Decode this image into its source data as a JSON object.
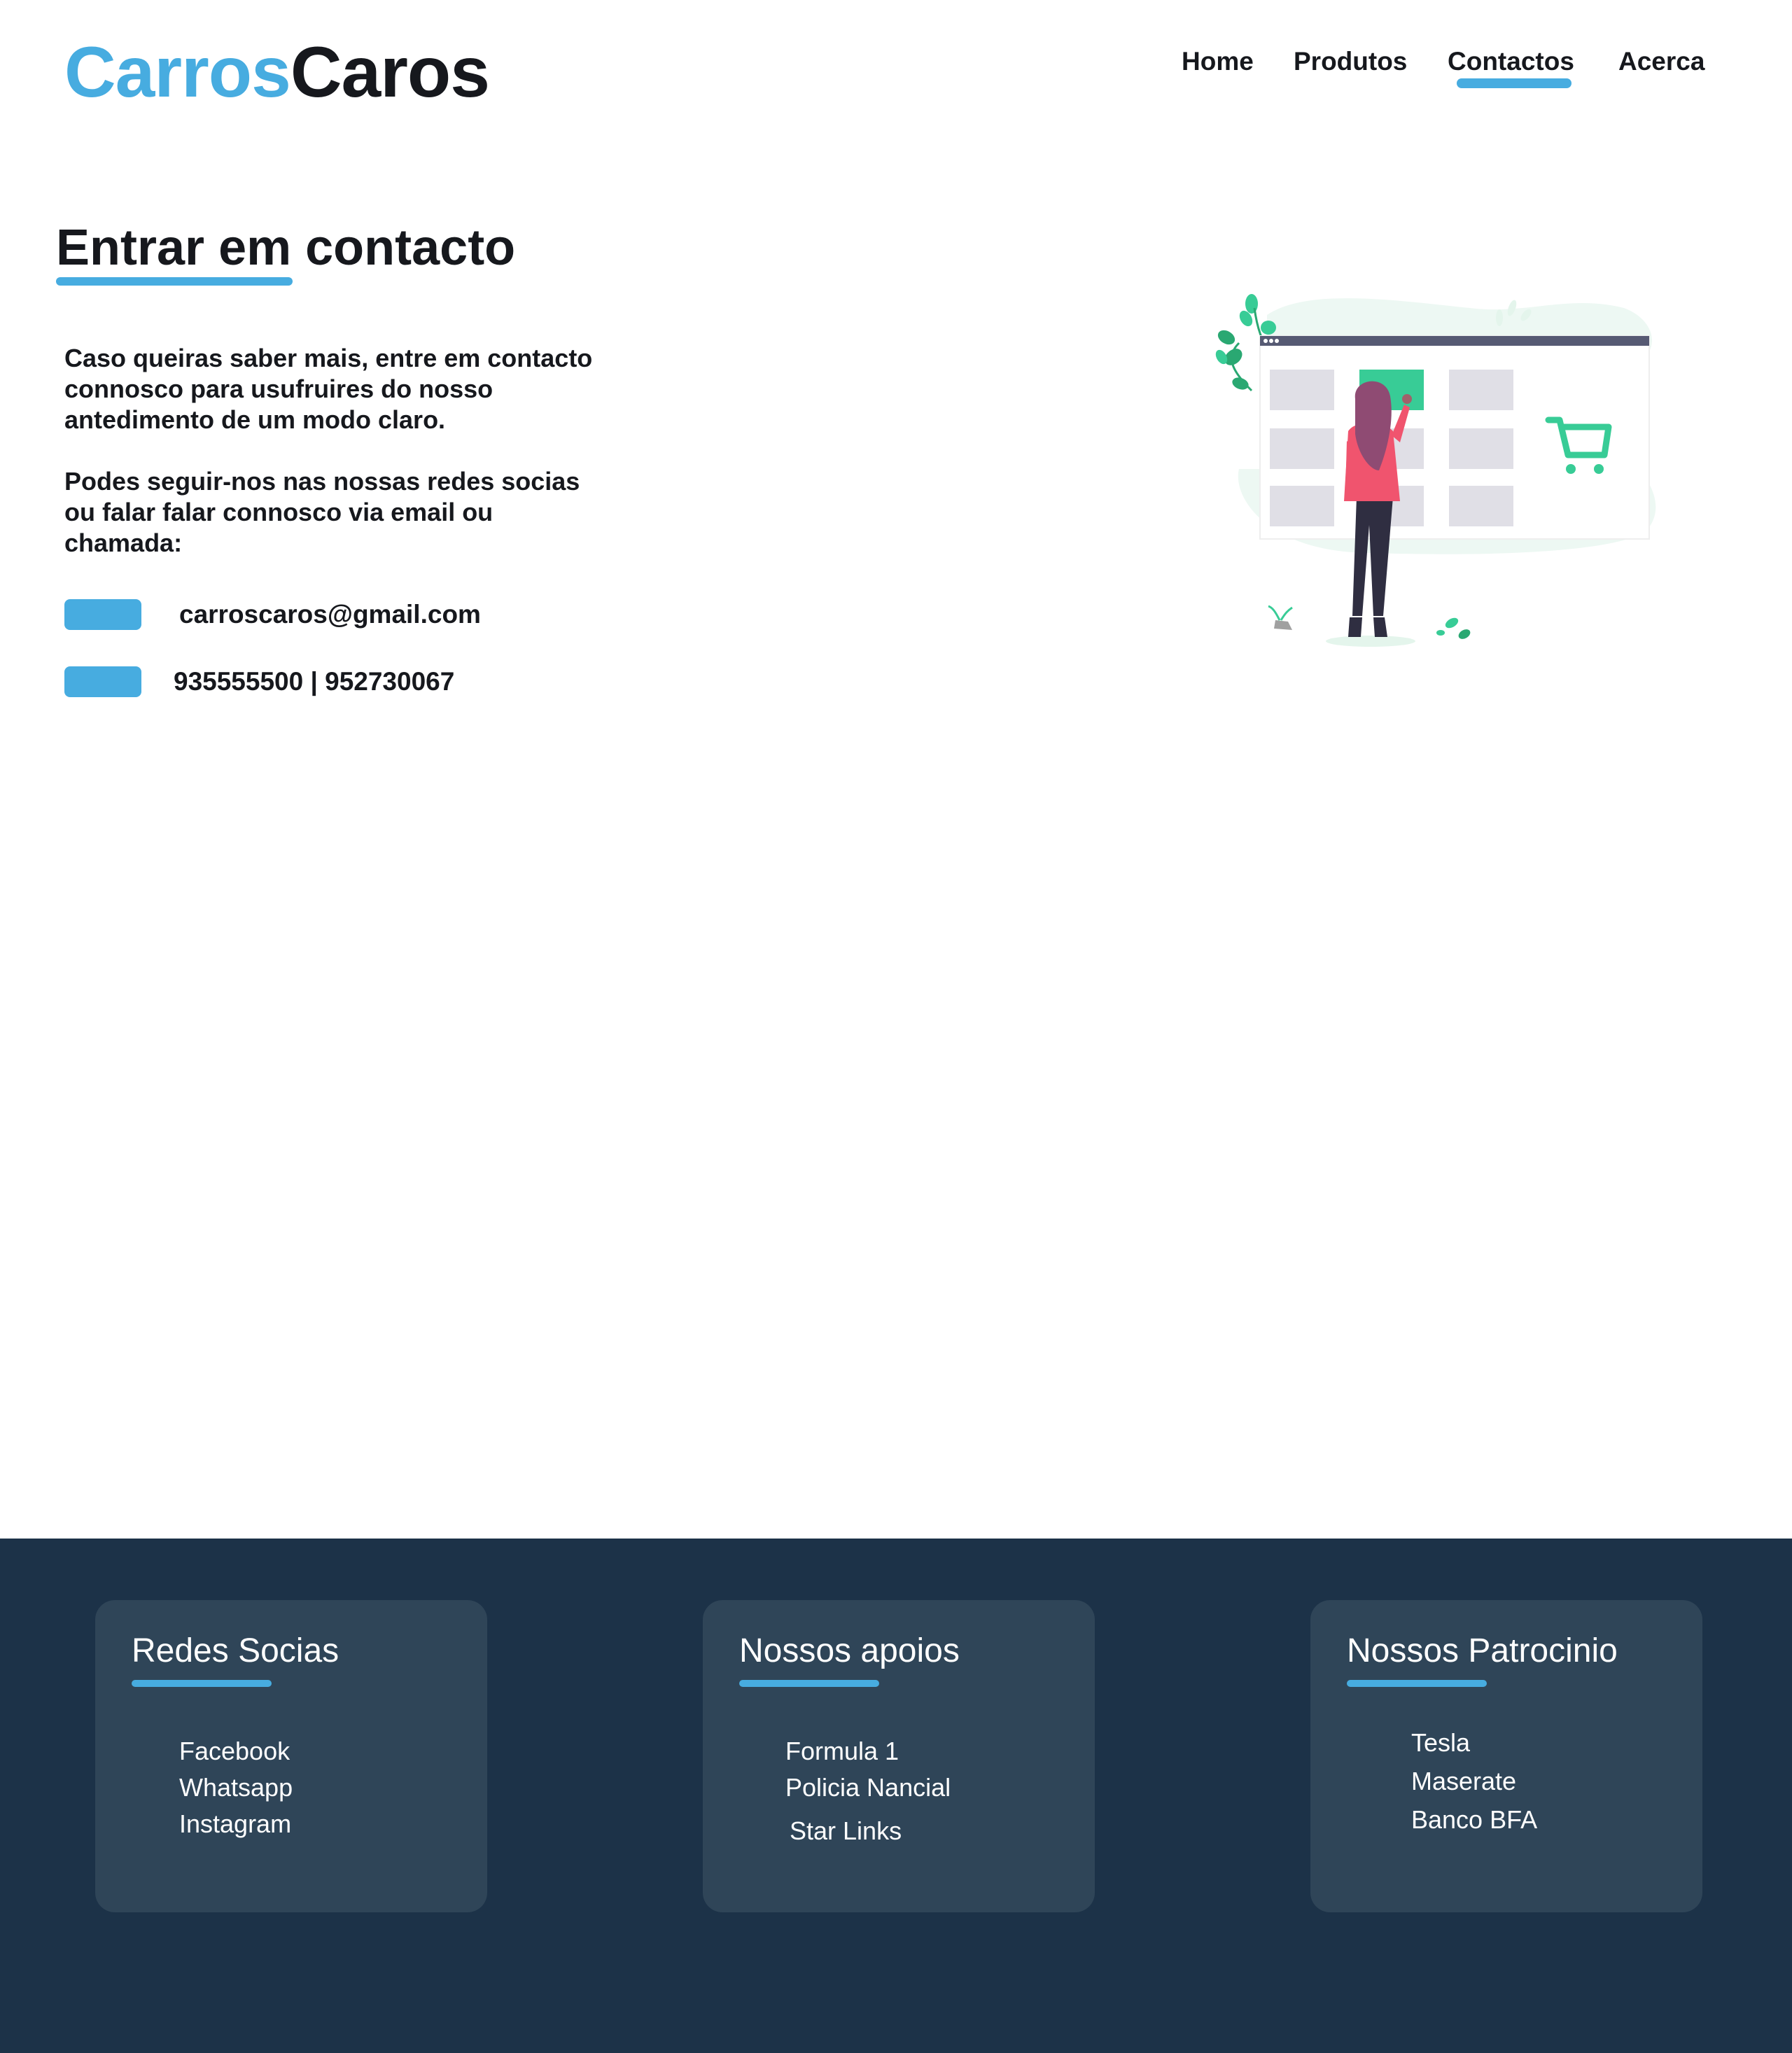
{
  "header": {
    "logo_part_a": "Carros",
    "logo_part_b": "Caros",
    "nav": {
      "home": "Home",
      "produtos": "Produtos",
      "contactos": "Contactos",
      "acerca": "Acerca",
      "active": "Contactos"
    }
  },
  "contact": {
    "title": "Entrar em contacto",
    "paragraph_1": "Caso queiras saber mais, entre em contacto connosco para usufruires do nosso antedimento de um modo claro.",
    "paragraph_2": "Podes seguir-nos nas nossas redes socias ou falar falar connosco via email ou chamada:",
    "email": "carroscaros@gmail.com",
    "phone": "935555500 | 952730067"
  },
  "footer": {
    "cards": [
      {
        "title": "Redes Socias",
        "items": [
          "Facebook",
          "Whatsapp",
          "Instagram"
        ]
      },
      {
        "title": "Nossos apoios",
        "items": [
          "Formula 1",
          "Policia Nancial",
          "Star Links"
        ]
      },
      {
        "title": "Nossos Patrocinio",
        "items": [
          "Tesla",
          "Maserate",
          "Banco BFA"
        ]
      }
    ]
  },
  "colors": {
    "accent": "#47ace0",
    "text": "#16181d",
    "footer_bg": "#1c3248",
    "footer_card": "#2f4558",
    "illustration_green": "#38cc96",
    "illustration_pink": "#f0546e"
  },
  "icons": {
    "email": "email-icon",
    "phone": "phone-icon"
  }
}
